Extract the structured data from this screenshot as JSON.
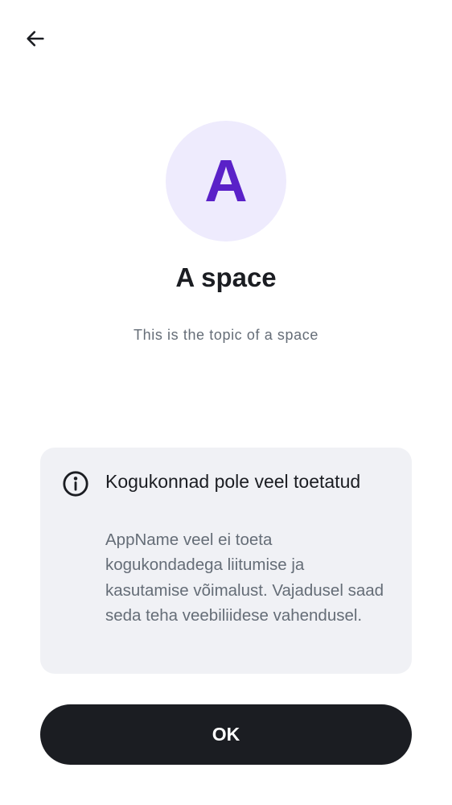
{
  "header": {
    "back_icon": "arrow-left-icon"
  },
  "space": {
    "avatar_letter": "A",
    "name": "A space",
    "topic": "This is the topic of a space"
  },
  "notice": {
    "icon": "info-icon",
    "title": "Kogukonnad pole veel toetatud",
    "body": "AppName veel ei toeta kogukondadega liitumise ja kasutamise võimalust. Vajadusel saad seda teha veebiliidese vahendusel."
  },
  "actions": {
    "ok_label": "OK"
  },
  "colors": {
    "avatar_bg": "#eeebfd",
    "avatar_letter": "#5a21c8",
    "card_bg": "#f0f1f5",
    "button_bg": "#1b1d22",
    "secondary_text": "#656d77"
  }
}
